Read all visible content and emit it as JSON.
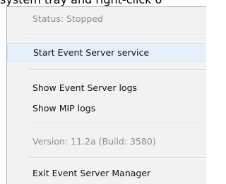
{
  "caption": "system tray and right-click o",
  "menu": {
    "status": "Status: Stopped",
    "start_service": "Start Event Server service",
    "show_event_logs": "Show Event Server logs",
    "show_mip_logs": "Show MIP logs",
    "version": "Version: 11.2a (Build: 3580)",
    "exit": "Exit Event Server Manager"
  }
}
